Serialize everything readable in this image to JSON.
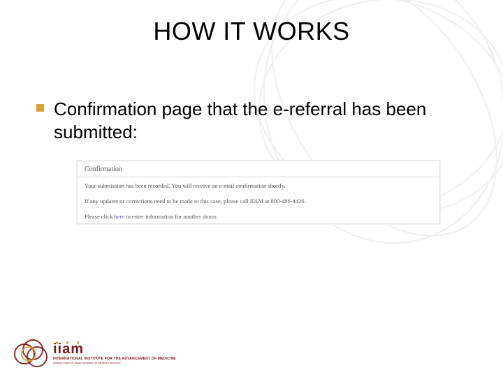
{
  "title": "HOW IT WORKS",
  "bullet": "Confirmation page that the e-referral has been submitted:",
  "panel": {
    "header": "Confirmation",
    "line1": "Your submission has been recorded. You will receive an e-mail confirmation shortly.",
    "line2": "If any updates or corrections need to be made to this case, please call IIAM at 800-486-4426.",
    "line3_pre": "Please click ",
    "line3_link": "here",
    "line3_post": " to enter information for another donor."
  },
  "logo": {
    "word": "iiam",
    "sub1": "INTERNATIONAL INSTITUTE FOR THE ADVANCEMENT OF MEDICINE",
    "sub2": "Linking Organ & Tissue Donation to Medical Discovery"
  }
}
